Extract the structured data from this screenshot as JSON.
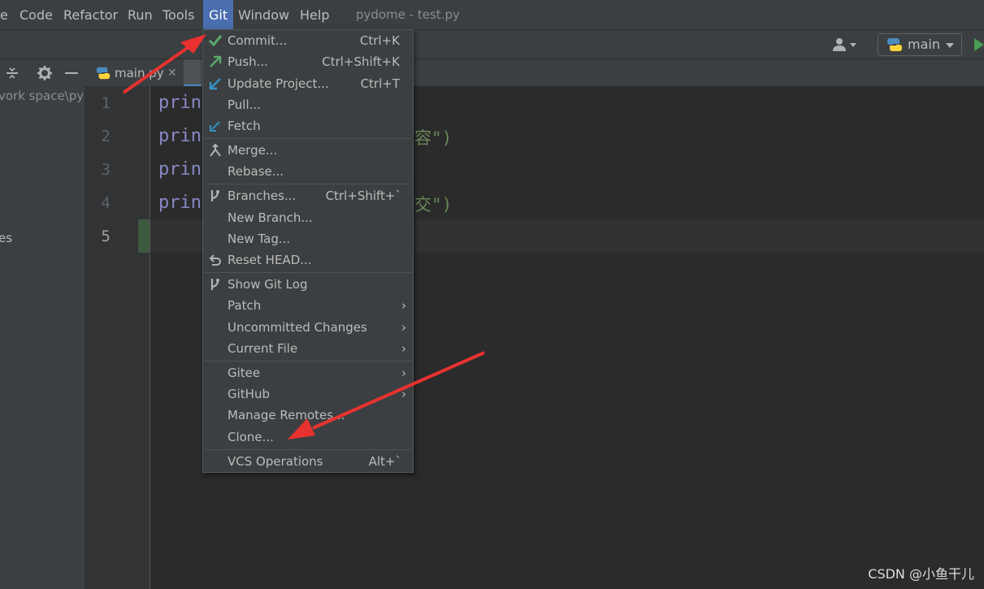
{
  "menubar": {
    "items": [
      "e",
      "Code",
      "Refactor",
      "Run",
      "Tools",
      "Git",
      "Window",
      "Help"
    ],
    "title": "pydome - test.py"
  },
  "toolbar": {
    "branch": "main"
  },
  "tabs": [
    {
      "label": "main.py"
    }
  ],
  "project_panel": {
    "path": "vork space\\pyd",
    "item": "es"
  },
  "editor": {
    "line_numbers": [
      "1",
      "2",
      "3",
      "4",
      "5"
    ],
    "lines": [
      {
        "code": "prin",
        "tail": ""
      },
      {
        "code": "prin",
        "tail": "容\")"
      },
      {
        "code": "prin",
        "tail": ""
      },
      {
        "code": "prin",
        "tail": "交\")"
      }
    ]
  },
  "git_menu": {
    "items": [
      {
        "label": "Commit...",
        "shortcut": "Ctrl+K",
        "icon": "check-icon"
      },
      {
        "label": "Push...",
        "shortcut": "Ctrl+Shift+K",
        "icon": "push-arrow-icon"
      },
      {
        "label": "Update Project...",
        "shortcut": "Ctrl+T",
        "icon": "update-arrow-icon"
      },
      {
        "label": "Pull...",
        "shortcut": ""
      },
      {
        "label": "Fetch",
        "shortcut": "",
        "icon": "fetch-icon"
      },
      {
        "label": "Merge...",
        "shortcut": "",
        "icon": "merge-icon"
      },
      {
        "label": "Rebase...",
        "shortcut": ""
      },
      {
        "label": "Branches...",
        "shortcut": "Ctrl+Shift+`",
        "icon": "branch-icon"
      },
      {
        "label": "New Branch...",
        "shortcut": ""
      },
      {
        "label": "New Tag...",
        "shortcut": ""
      },
      {
        "label": "Reset HEAD...",
        "shortcut": "",
        "icon": "undo-icon"
      },
      {
        "label": "Show Git Log",
        "shortcut": "",
        "icon": "git-log-icon"
      },
      {
        "label": "Patch",
        "submenu": true
      },
      {
        "label": "Uncommitted Changes",
        "submenu": true
      },
      {
        "label": "Current File",
        "submenu": true
      },
      {
        "label": "Gitee",
        "submenu": true
      },
      {
        "label": "GitHub",
        "submenu": true
      },
      {
        "label": "Manage Remotes...",
        "shortcut": ""
      },
      {
        "label": "Clone...",
        "shortcut": ""
      },
      {
        "label": "VCS Operations",
        "shortcut": "Alt+`"
      }
    ]
  },
  "watermark": "CSDN @小鱼干儿",
  "colors": {
    "accent": "#4b6eaf",
    "arrow": "#e8322f",
    "string": "#6a8759",
    "keyword": "#8888c6"
  }
}
